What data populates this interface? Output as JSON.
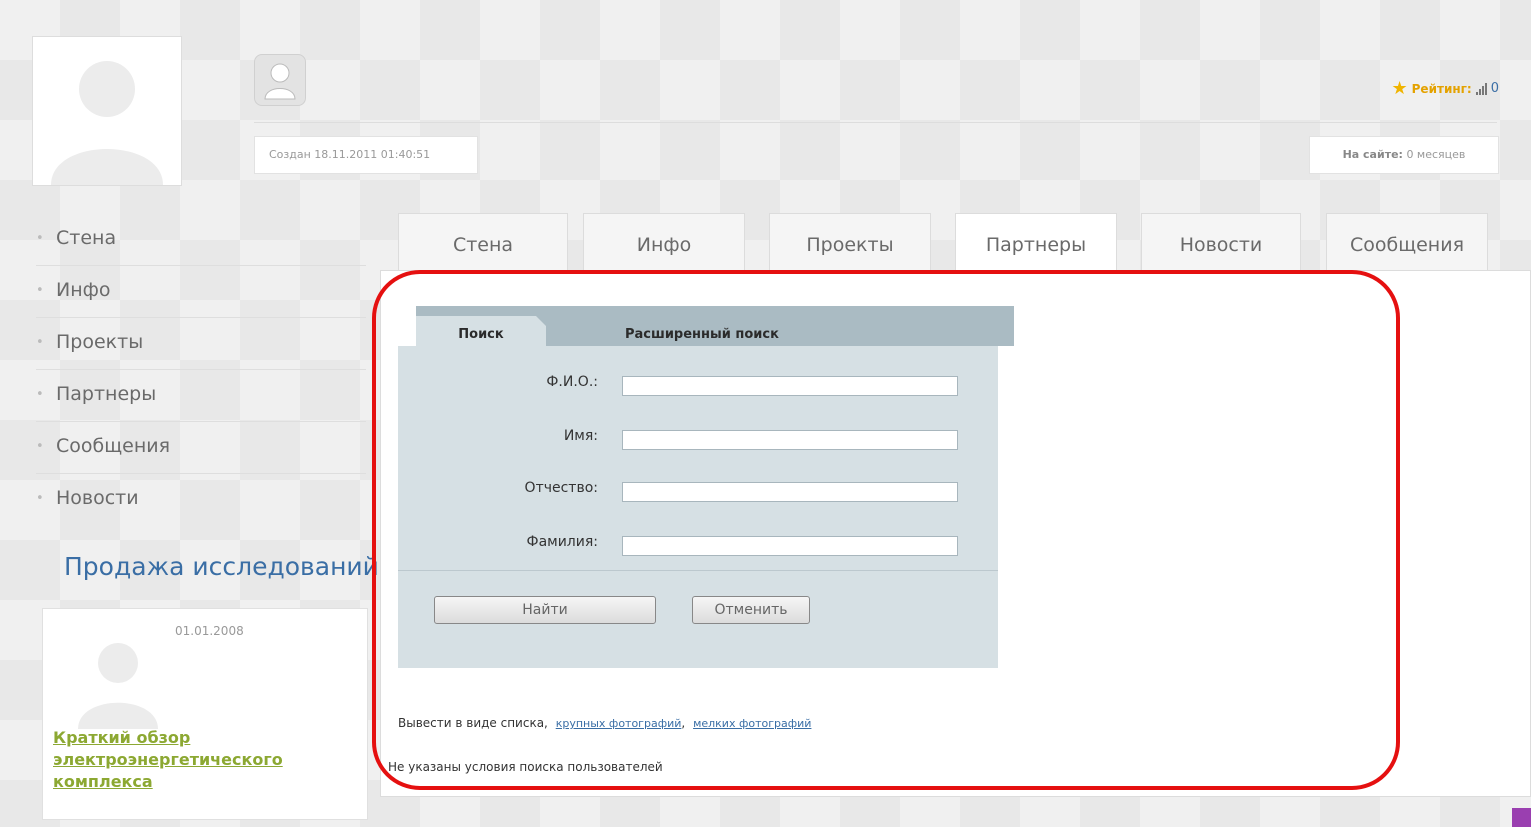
{
  "profile": {
    "created_text": "Создан 18.11.2011 01:40:51",
    "rating_label": "Рейтинг:",
    "rating_value": "0",
    "online_label": "На сайте:",
    "online_value": "0 месяцев"
  },
  "sidebar": {
    "items": [
      {
        "label": "Стена"
      },
      {
        "label": "Инфо"
      },
      {
        "label": "Проекты"
      },
      {
        "label": "Партнеры"
      },
      {
        "label": "Сообщения"
      },
      {
        "label": "Новости"
      }
    ],
    "sales_title": "Продажа исследований",
    "sales_date": "01.01.2008",
    "sales_article": "Краткий обзор электроэнергетического комплекса"
  },
  "tabs": [
    {
      "label": "Стена"
    },
    {
      "label": "Инфо"
    },
    {
      "label": "Проекты"
    },
    {
      "label": "Партнеры",
      "active": true
    },
    {
      "label": "Новости"
    },
    {
      "label": "Сообщения"
    }
  ],
  "search": {
    "tab_search": "Поиск",
    "tab_advanced": "Расширенный поиск",
    "fields": {
      "fio": {
        "label": "Ф.И.О.:",
        "value": ""
      },
      "first_name": {
        "label": "Имя:",
        "value": ""
      },
      "patronymic": {
        "label": "Отчество:",
        "value": ""
      },
      "last_name": {
        "label": "Фамилия:",
        "value": ""
      }
    },
    "find_button": "Найти",
    "cancel_button": "Отменить"
  },
  "results": {
    "view_prefix": "Вывести в виде  списка,",
    "view_large": "крупных фотографий",
    "view_small": "мелких фотографий",
    "separator": ",",
    "empty_message": "Не указаны условия поиска пользователей"
  },
  "colors": {
    "accent": "#3a6ea5",
    "highlight": "#e51010",
    "article_link": "#8ca832",
    "search_panel": "#d6e0e4"
  }
}
